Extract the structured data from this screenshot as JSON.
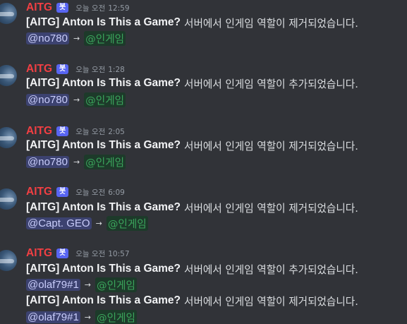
{
  "messages": [
    {
      "author": "AITG",
      "bot_tag": "봇",
      "day": "오늘",
      "period": "오전",
      "time": "12:59",
      "lines": [
        {
          "game": "[AITG] Anton Is This a Game?",
          "desc": "서버에서 인게임 역할이 제거되었습니다.",
          "user": "@no780",
          "arrow": "→",
          "role": "@인게임"
        }
      ]
    },
    {
      "author": "AITG",
      "bot_tag": "봇",
      "day": "오늘",
      "period": "오전",
      "time": "1:28",
      "lines": [
        {
          "game": "[AITG] Anton Is This a Game?",
          "desc": "서버에서 인게임 역할이 추가되었습니다.",
          "user": "@no780",
          "arrow": "→",
          "role": "@인게임"
        }
      ]
    },
    {
      "author": "AITG",
      "bot_tag": "봇",
      "day": "오늘",
      "period": "오전",
      "time": "2:05",
      "lines": [
        {
          "game": "[AITG] Anton Is This a Game?",
          "desc": "서버에서 인게임 역할이 제거되었습니다.",
          "user": "@no780",
          "arrow": "→",
          "role": "@인게임"
        }
      ]
    },
    {
      "author": "AITG",
      "bot_tag": "봇",
      "day": "오늘",
      "period": "오전",
      "time": "6:09",
      "lines": [
        {
          "game": "[AITG] Anton Is This a Game?",
          "desc": "서버에서 인게임 역할이 제거되었습니다.",
          "user": "@Capt. GEO",
          "arrow": "→",
          "role": "@인게임"
        }
      ]
    },
    {
      "author": "AITG",
      "bot_tag": "봇",
      "day": "오늘",
      "period": "오전",
      "time": "10:57",
      "lines": [
        {
          "game": "[AITG] Anton Is This a Game?",
          "desc": "서버에서 인게임 역할이 추가되었습니다.",
          "user": "@olaf79#1",
          "arrow": "→",
          "role": "@인게임"
        },
        {
          "game": "[AITG] Anton Is This a Game?",
          "desc": "서버에서 인게임 역할이 제거되었습니다.",
          "user": "@olaf79#1",
          "arrow": "→",
          "role": "@인게임"
        }
      ]
    }
  ],
  "colors": {
    "background": "#313338",
    "author": "#f23f43",
    "bot_tag": "#5865f2",
    "user_mention_bg": "#3c4270",
    "role_mention_text": "#3ba55c"
  },
  "icons": {
    "avatar": "bot-avatar-icon",
    "arrow": "right-arrow-glyph"
  }
}
